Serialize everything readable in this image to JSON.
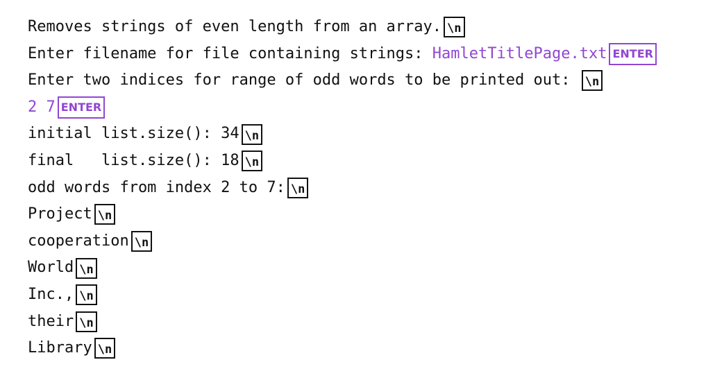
{
  "colors": {
    "output": "#111111",
    "user_input": "#9146d2"
  },
  "markers": {
    "newline": "\\n",
    "enter": "ENTER"
  },
  "lines": [
    {
      "text": "Removes strings of even length from an array.",
      "marker": "newline"
    },
    {
      "text": "Enter filename for file containing strings: ",
      "input": "HamletTitlePage.txt",
      "marker": "enter"
    },
    {
      "text": "Enter two indices for range of odd words to be printed out: ",
      "marker": "newline"
    },
    {
      "text": "",
      "input": "2 7",
      "marker": "enter"
    },
    {
      "text": "initial list.size(): 34",
      "marker": "newline"
    },
    {
      "text": "final   list.size(): 18",
      "marker": "newline"
    },
    {
      "text": "odd words from index 2 to 7:",
      "marker": "newline"
    },
    {
      "text": "Project",
      "marker": "newline"
    },
    {
      "text": "cooperation",
      "marker": "newline"
    },
    {
      "text": "World",
      "marker": "newline"
    },
    {
      "text": "Inc.,",
      "marker": "newline"
    },
    {
      "text": "their",
      "marker": "newline"
    },
    {
      "text": "Library",
      "marker": "newline"
    }
  ]
}
